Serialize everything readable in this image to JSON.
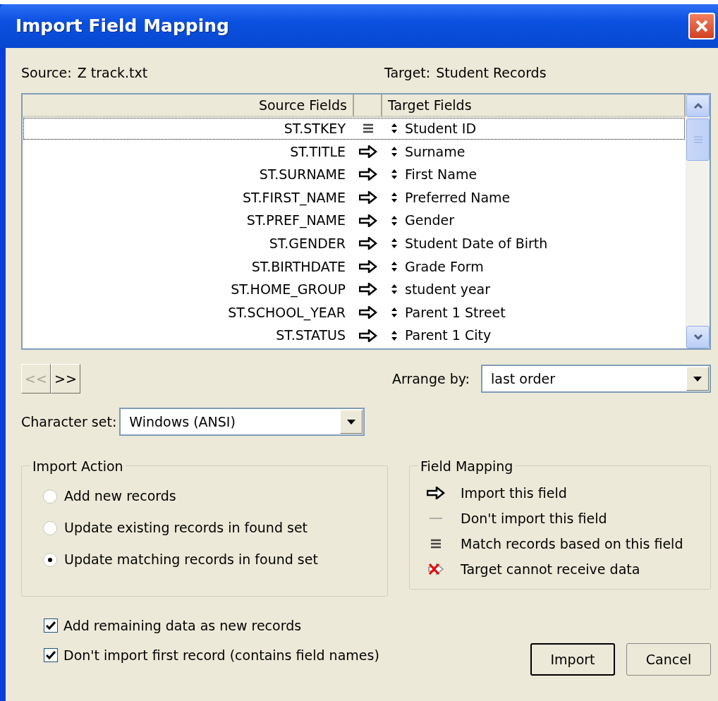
{
  "window": {
    "title": "Import Field Mapping"
  },
  "source": {
    "label": "Source:",
    "value": "Z track.txt"
  },
  "target": {
    "label": "Target:",
    "value": "Student Records"
  },
  "mapping_table": {
    "columns": [
      "Source Fields",
      "Target Fields"
    ],
    "rows": [
      {
        "source": "ST.STKEY",
        "kind": "match",
        "target": "Student ID",
        "selected": true
      },
      {
        "source": "ST.TITLE",
        "kind": "import",
        "target": "Surname",
        "selected": false
      },
      {
        "source": "ST.SURNAME",
        "kind": "import",
        "target": "First Name",
        "selected": false
      },
      {
        "source": "ST.FIRST_NAME",
        "kind": "import",
        "target": "Preferred Name",
        "selected": false
      },
      {
        "source": "ST.PREF_NAME",
        "kind": "import",
        "target": "Gender",
        "selected": false
      },
      {
        "source": "ST.GENDER",
        "kind": "import",
        "target": "Student Date of Birth",
        "selected": false
      },
      {
        "source": "ST.BIRTHDATE",
        "kind": "import",
        "target": "Grade Form",
        "selected": false
      },
      {
        "source": "ST.HOME_GROUP",
        "kind": "import",
        "target": "student year",
        "selected": false
      },
      {
        "source": "ST.SCHOOL_YEAR",
        "kind": "import",
        "target": "Parent 1 Street",
        "selected": false
      },
      {
        "source": "ST.STATUS",
        "kind": "import",
        "target": "Parent 1 City",
        "selected": false
      }
    ]
  },
  "nav_buttons": [
    {
      "label": "<<",
      "disabled": true
    },
    {
      "label": ">>",
      "disabled": false
    }
  ],
  "arrange_by": {
    "label": "Arrange by:",
    "value": "last order"
  },
  "character_set": {
    "label": "Character set:",
    "value": "Windows (ANSI)"
  },
  "import_action": {
    "title": "Import Action",
    "options": [
      {
        "label": "Add new records",
        "selected": false
      },
      {
        "label": "Update existing records in found set",
        "selected": false
      },
      {
        "label": "Update matching records in found set",
        "selected": true
      }
    ]
  },
  "field_mapping_legend": {
    "title": "Field Mapping",
    "items": [
      {
        "kind": "import",
        "label": "Import this field"
      },
      {
        "kind": "skip",
        "label": "Don't import this field"
      },
      {
        "kind": "match",
        "label": "Match records based on this field"
      },
      {
        "kind": "blocked",
        "label": "Target cannot receive data"
      }
    ]
  },
  "checkboxes": [
    {
      "label": "Add remaining data as new records",
      "checked": true
    },
    {
      "label": "Don't import first record (contains field names)",
      "checked": true
    }
  ],
  "buttons": [
    {
      "label": "Import",
      "default": true
    },
    {
      "label": "Cancel",
      "default": false
    }
  ]
}
